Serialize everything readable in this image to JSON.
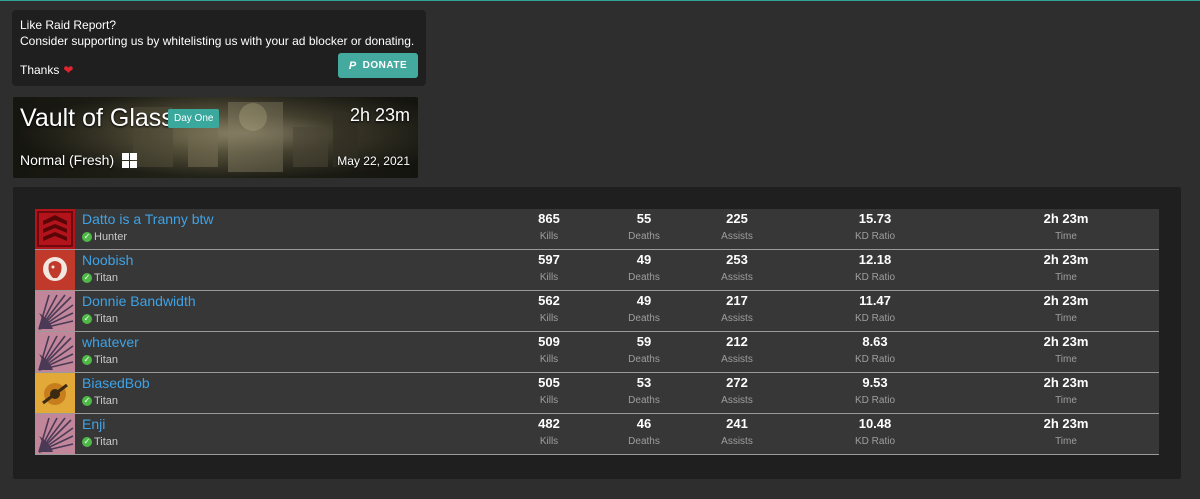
{
  "support": {
    "line1": "Like Raid Report?",
    "line2": "Consider supporting us by whitelisting us with your ad blocker or donating.",
    "thanks": "Thanks",
    "heart": "❤",
    "donate_label": "DONATE",
    "donate_icon": "P"
  },
  "raid": {
    "title": "Vault of Glass",
    "badge": "Day One",
    "duration": "2h 23m",
    "mode": "Normal (Fresh)",
    "platform_icon": "windows-icon",
    "date": "May 22, 2021"
  },
  "labels": {
    "kills": "Kills",
    "deaths": "Deaths",
    "assists": "Assists",
    "kd": "KD Ratio",
    "time": "Time"
  },
  "players": [
    {
      "name": "Datto is a Tranny btw",
      "class": "Hunter",
      "kills": "865",
      "deaths": "55",
      "assists": "225",
      "kd": "15.73",
      "time": "2h 23m",
      "emblem": "red-cross-emblem"
    },
    {
      "name": "Noobish",
      "class": "Titan",
      "kills": "597",
      "deaths": "49",
      "assists": "253",
      "kd": "12.18",
      "time": "2h 23m",
      "emblem": "lion-emblem"
    },
    {
      "name": "Donnie Bandwidth",
      "class": "Titan",
      "kills": "562",
      "deaths": "49",
      "assists": "217",
      "kd": "11.47",
      "time": "2h 23m",
      "emblem": "pink-fan-emblem"
    },
    {
      "name": "whatever",
      "class": "Titan",
      "kills": "509",
      "deaths": "59",
      "assists": "212",
      "kd": "8.63",
      "time": "2h 23m",
      "emblem": "pink-fan-emblem"
    },
    {
      "name": "BiasedBob",
      "class": "Titan",
      "kills": "505",
      "deaths": "53",
      "assists": "272",
      "kd": "9.53",
      "time": "2h 23m",
      "emblem": "gold-emblem"
    },
    {
      "name": "Enji",
      "class": "Titan",
      "kills": "482",
      "deaths": "46",
      "assists": "241",
      "kd": "10.48",
      "time": "2h 23m",
      "emblem": "pink-fan-emblem"
    }
  ]
}
